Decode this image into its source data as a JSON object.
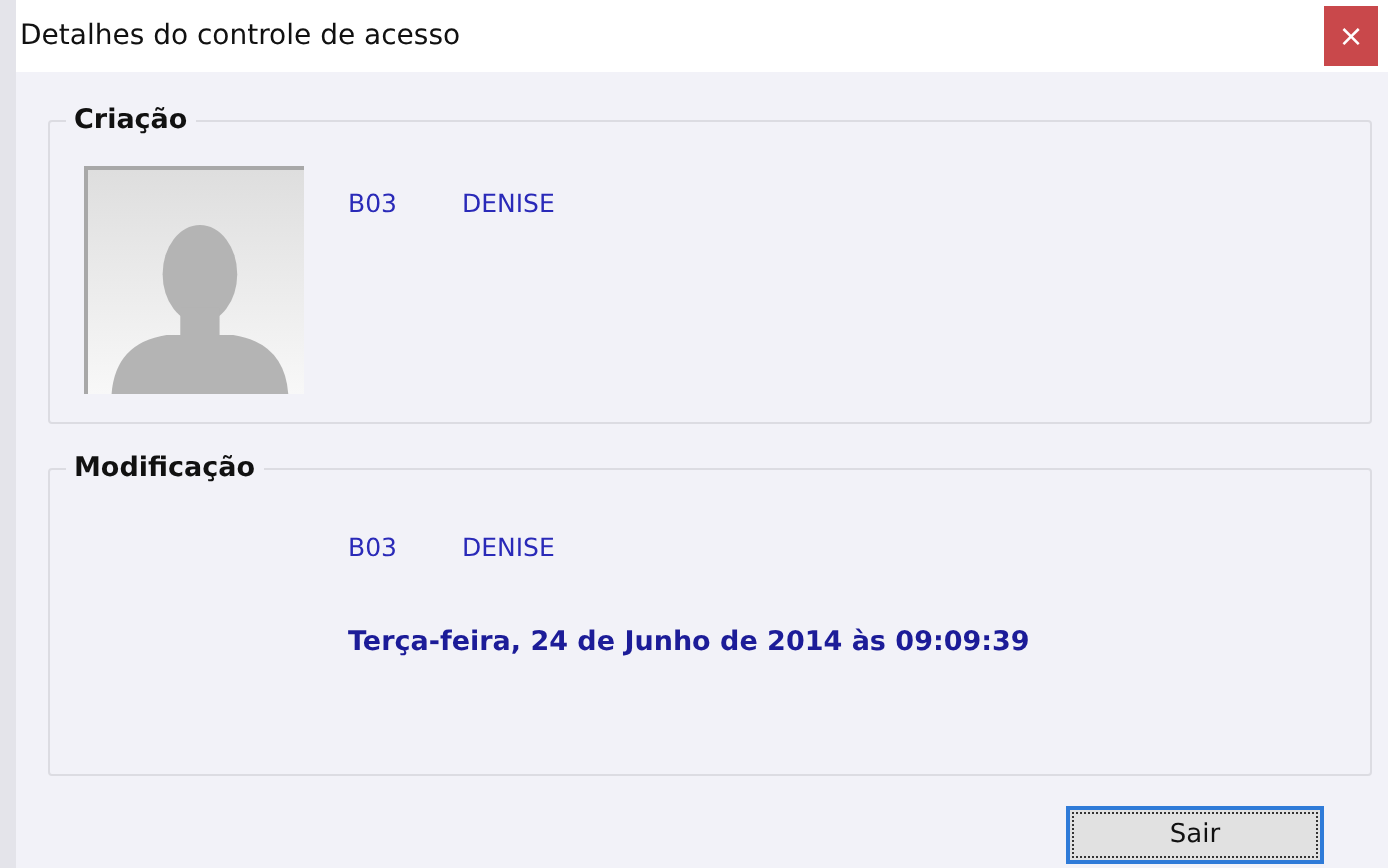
{
  "window": {
    "title": "Detalhes do controle de acesso",
    "close": "×"
  },
  "groups": [
    {
      "kind": "photo",
      "title": "Criação",
      "code": "B03",
      "user": "DENISE"
    },
    {
      "kind": "plain",
      "title": "Modificação",
      "code": "B03",
      "user": "DENISE",
      "timestamp": "Terça-feira, 24 de Junho de 2014 às 09:09:39"
    }
  ],
  "buttons": [
    {
      "label": "Sair",
      "focused": true
    }
  ]
}
